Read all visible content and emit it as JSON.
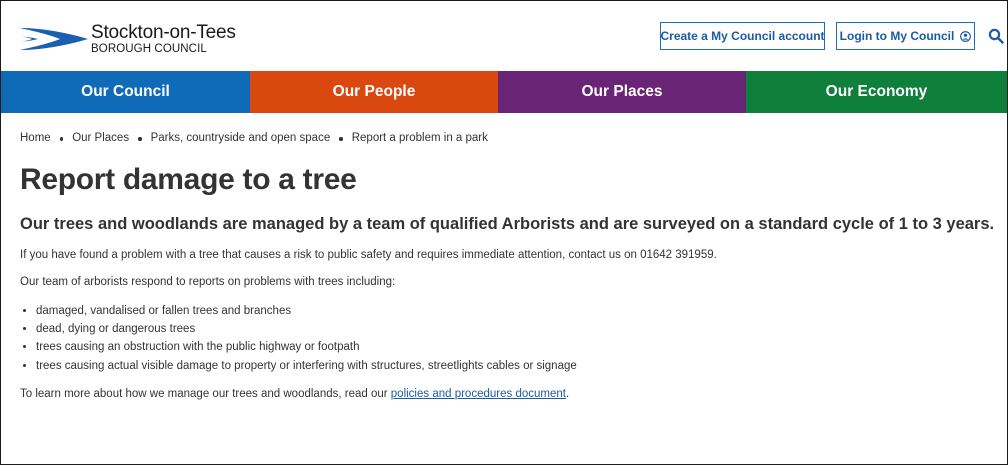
{
  "header": {
    "logo_title": "Stockton-on-Tees",
    "logo_subtitle": "BOROUGH COUNCIL",
    "create_account_label": "Create a My Council account",
    "login_label": "Login to My Council"
  },
  "nav": {
    "items": [
      {
        "label": "Our Council",
        "color": "#0f6bb8"
      },
      {
        "label": "Our People",
        "color": "#d9480f"
      },
      {
        "label": "Our Places",
        "color": "#6a2476"
      },
      {
        "label": "Our Economy",
        "color": "#0f7f3c"
      }
    ]
  },
  "breadcrumb": {
    "items": [
      "Home",
      "Our Places",
      "Parks, countryside and open space",
      "Report a problem in a park"
    ]
  },
  "page": {
    "title": "Report damage to a tree",
    "lead": "Our trees and woodlands are managed by a team of qualified Arborists and are surveyed on a standard cycle of 1 to 3 years.",
    "para1": "If you have found a problem with a tree that causes a risk to public safety and requires immediate attention, contact us on 01642 391959.",
    "para2": "Our team of arborists respond to reports on problems with trees including:",
    "list": [
      "damaged, vandalised or fallen trees and branches",
      "dead, dying or dangerous trees",
      "trees causing an obstruction with the public highway or footpath",
      "trees causing actual visible damage to property or interfering with structures, streetlights cables or signage"
    ],
    "para3_prefix": "To learn more about how we manage our trees and woodlands, read our ",
    "para3_link": "policies and procedures document",
    "para3_suffix": "."
  },
  "icons": {
    "logo": "swoosh-logo-icon",
    "user": "user-circle-icon",
    "search": "search-icon"
  },
  "colors": {
    "link": "#1a5aa6",
    "logo_blue": "#1b5fb0"
  }
}
